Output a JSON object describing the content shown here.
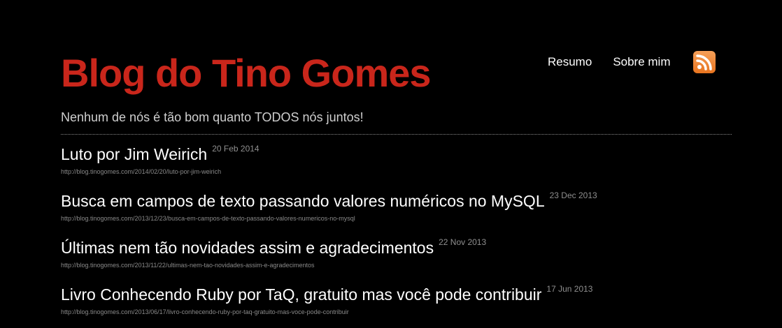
{
  "header": {
    "title": "Blog do Tino Gomes",
    "tagline": "Nenhum de nós é tão bom quanto TODOS nós juntos!"
  },
  "nav": {
    "items": [
      {
        "label": "Resumo"
      },
      {
        "label": "Sobre mim"
      }
    ],
    "rss_icon": "rss-feed-icon"
  },
  "colors": {
    "background": "#000000",
    "title": "#c9261b",
    "text": "#ffffff",
    "muted": "#8a8a8a",
    "rss": "#e8741f"
  },
  "posts": [
    {
      "title": "Luto por Jim Weirich",
      "date": "20 Feb 2014",
      "url": "http://blog.tinogomes.com/2014/02/20/luto-por-jim-weirich"
    },
    {
      "title": "Busca em campos de texto passando valores numéricos no MySQL",
      "date": "23 Dec 2013",
      "url": "http://blog.tinogomes.com/2013/12/23/busca-em-campos-de-texto-passando-valores-numericos-no-mysql"
    },
    {
      "title": "Últimas nem tão novidades assim e agradecimentos",
      "date": "22 Nov 2013",
      "url": "http://blog.tinogomes.com/2013/11/22/ultimas-nem-tao-novidades-assim-e-agradecimentos"
    },
    {
      "title": "Livro Conhecendo Ruby por TaQ, gratuito mas você pode contribuir",
      "date": "17 Jun 2013",
      "url": "http://blog.tinogomes.com/2013/06/17/livro-conhecendo-ruby-por-taq-gratuito-mas-voce-pode-contribuir"
    }
  ]
}
